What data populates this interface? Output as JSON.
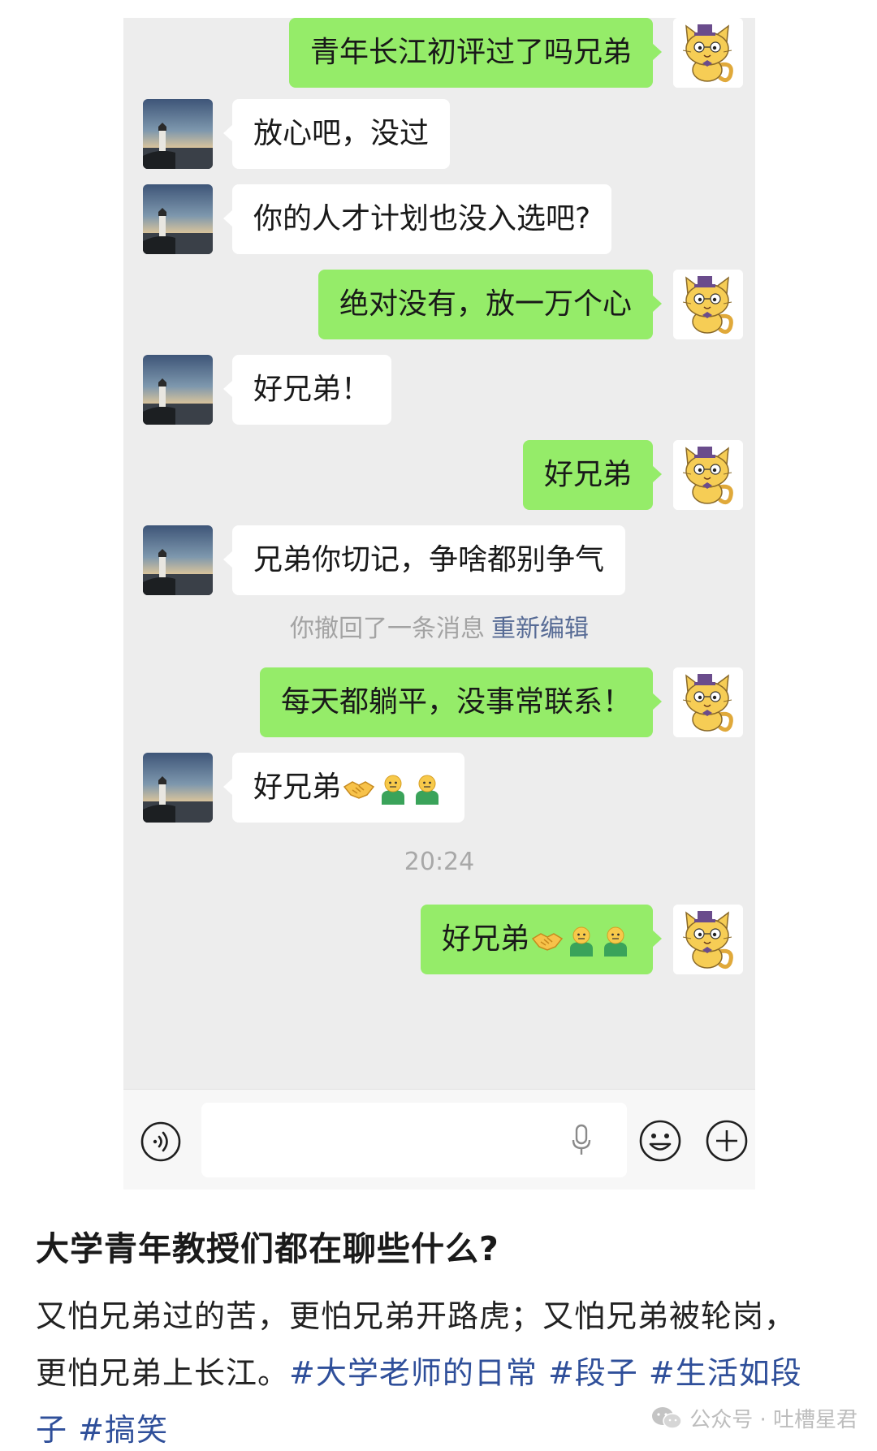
{
  "chat": {
    "messages": [
      {
        "side": "right",
        "text": "青年长江初评过了吗兄弟"
      },
      {
        "side": "left",
        "text": "放心吧，没过"
      },
      {
        "side": "left",
        "text": "你的人才计划也没入选吧?"
      },
      {
        "side": "right",
        "text": "绝对没有，放一万个心"
      },
      {
        "side": "left",
        "text": "好兄弟！"
      },
      {
        "side": "right",
        "text": "好兄弟"
      },
      {
        "side": "left",
        "text": "兄弟你切记，争啥都别争气"
      },
      {
        "side": "right",
        "text": "每天都躺平，没事常联系！"
      },
      {
        "side": "left",
        "text": "好兄弟"
      },
      {
        "side": "right",
        "text": "好兄弟"
      }
    ],
    "recall_notice": "你撤回了一条消息",
    "recall_action": "重新编辑",
    "timestamp": "20:24"
  },
  "post": {
    "title": "大学青年教授们都在聊些什么?",
    "body_text": "又怕兄弟过的苦，更怕兄弟开路虎；又怕兄弟被轮岗，更怕兄弟上长江。",
    "hashtags": [
      "#大学老师的日常",
      "#段子",
      "#生活如段子",
      "#搞笑"
    ]
  },
  "watermark": {
    "text": "公众号 · 吐槽星君"
  },
  "colors": {
    "outgoing_bubble": "#95ec69",
    "incoming_bubble": "#ffffff",
    "chat_background": "#ededed",
    "link": "#576b95",
    "hashtag": "#2f4f9a"
  },
  "icons": [
    "voice-icon",
    "mic-icon",
    "emoji-icon",
    "plus-icon",
    "handshake-emoji",
    "person-emoji",
    "wechat-icon"
  ]
}
